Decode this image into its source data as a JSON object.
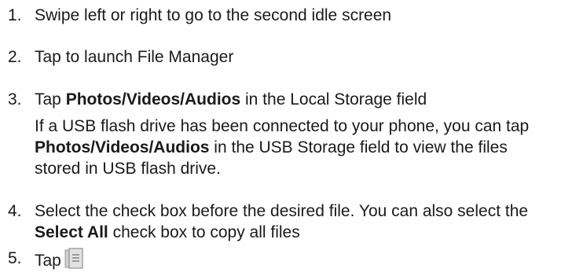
{
  "steps": [
    {
      "number": "1.",
      "text": "Swipe left or right to go to the second idle screen"
    },
    {
      "number": "2.",
      "text": "Tap to launch File Manager"
    },
    {
      "number": "3.",
      "pre": "Tap ",
      "bold": "Photos/Videos/Audios",
      "post": " in the Local Storage field"
    },
    {
      "number": "4.",
      "pre": "Select the check box before the desired file. You can also select the ",
      "bold": "Select All",
      "post": " check box to copy all files"
    },
    {
      "number": "5.",
      "text": "Tap",
      "icon": "copy-icon"
    }
  ],
  "note": {
    "pre": "If a USB flash drive has been connected to your phone, you can tap ",
    "bold": "Photos/Videos/Audios",
    "post": " in the USB Storage field to view the files stored in USB flash drive."
  }
}
